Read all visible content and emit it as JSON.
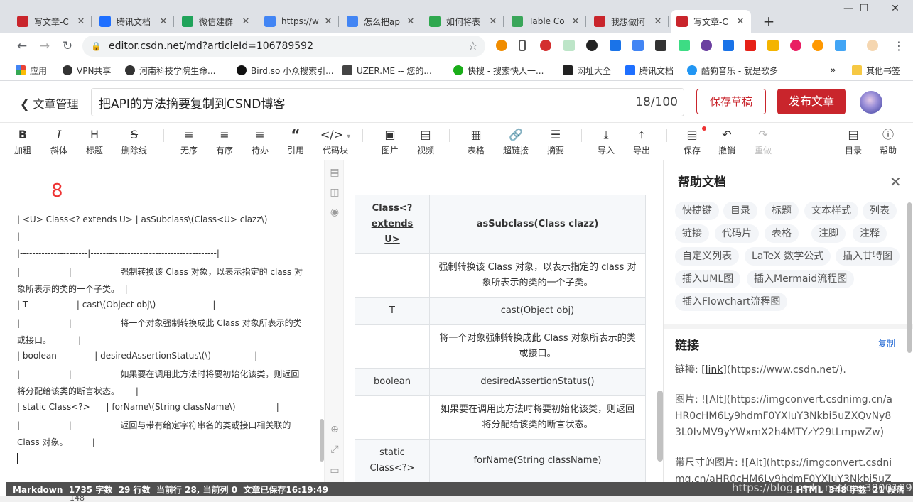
{
  "browser": {
    "tabs": [
      {
        "title": "写文章-C",
        "favicon": "csdn-c-icon",
        "color": "#c9252c"
      },
      {
        "title": "腾讯文档",
        "favicon": "tencent-docs-icon",
        "color": "#1e6fff"
      },
      {
        "title": "微信建群",
        "favicon": "sheet-icon",
        "color": "#20a35a"
      },
      {
        "title": "https://w",
        "favicon": "google-g-icon",
        "color": "#4285f4"
      },
      {
        "title": "怎么把ap",
        "favicon": "google-g-icon",
        "color": "#4285f4"
      },
      {
        "title": "如何将表",
        "favicon": "green-c-icon",
        "color": "#2fa84f"
      },
      {
        "title": "Table Co",
        "favicon": "grid-app-icon",
        "color": "#3aa65a"
      },
      {
        "title": "我想做阿",
        "favicon": "csdn-c-icon",
        "color": "#c9252c"
      },
      {
        "title": "写文章-C",
        "favicon": "csdn-c-icon",
        "color": "#c9252c"
      }
    ],
    "new_tab": "+",
    "url": "editor.csdn.net/md?articleId=106789592",
    "bookmarks": [
      "应用",
      "VPN共享",
      "河南科技学院生命...",
      "Bird.so 小众搜索引...",
      "UZER.ME -- 您的...",
      "快搜 - 搜索快人一...",
      "网址大全",
      "腾讯文档",
      "酷狗音乐 - 就是歌多"
    ],
    "bookmarks_more": "»",
    "other_bookmarks": "其他书签"
  },
  "editor": {
    "back_label": "文章管理",
    "title": "把API的方法摘要复制到CSND博客",
    "title_count": "18/100",
    "save_draft": "保存草稿",
    "publish": "发布文章"
  },
  "toolbar": {
    "bold": "加粗",
    "italic": "斜体",
    "heading": "标题",
    "strike": "删除线",
    "unordered": "无序",
    "ordered": "有序",
    "todo": "待办",
    "quote": "引用",
    "codeblock": "代码块",
    "image": "图片",
    "video": "视频",
    "table": "表格",
    "link": "超链接",
    "summary": "摘要",
    "import": "导入",
    "export": "导出",
    "save": "保存",
    "undo": "撤销",
    "redo": "重做",
    "toc": "目录",
    "help": "帮助"
  },
  "markdown": {
    "big_number": "8",
    "lines": [
      "| <U> Class<? extends U> | asSubclass\\(Class<U> clazz\\)",
      "|",
      "|----------------------|-----------------------------------------|",
      "|                  |                  强制转换该 Class 对象，以表示指定的 class 对",
      "象所表示的类的一个子类。  |",
      "| T                  | cast\\(Object obj\\)                     |",
      "|                  |                  将一个对象强制转换成此 Class 对象所表示的类",
      "或接口。          |",
      "| boolean              | desiredAssertionStatus\\(\\)                |",
      "|                  |                  如果要在调用此方法时将要初始化该类，则返回",
      "将分配给该类的断言状态。      |",
      "| static Class<?>      | forName\\(String className\\)               |",
      "|                  |                  返回与带有给定字符串名的类或接口相关联的",
      "Class 对象。         |"
    ]
  },
  "preview": {
    "header": [
      "Class<? extends U>",
      "asSubclass(Class clazz)"
    ],
    "rows": [
      [
        "",
        "强制转换该 Class 对象，以表示指定的 class 对象所表示的类的一个子类。"
      ],
      [
        "T",
        "cast(Object obj)"
      ],
      [
        "",
        "将一个对象强制转换成此 Class 对象所表示的类或接口。"
      ],
      [
        "boolean",
        "desiredAssertionStatus()"
      ],
      [
        "",
        "如果要在调用此方法时将要初始化该类，则返回将分配给该类的断言状态。"
      ],
      [
        "static Class<?>",
        "forName(String className)"
      ],
      [
        "",
        "返回与带有给定字符串名的类或接口相关联的"
      ]
    ]
  },
  "help": {
    "title": "帮助文档",
    "chips": [
      "快捷键",
      "目录",
      "标题",
      "文本样式",
      "列表",
      "链接",
      "代码片",
      "表格",
      "注脚",
      "注释",
      "自定义列表",
      "LaTeX 数学公式",
      "插入甘特图",
      "插入UML图",
      "插入Mermaid流程图",
      "插入Flowchart流程图"
    ],
    "section_title": "链接",
    "copy": "复制",
    "link_prefix": "链接: [",
    "link_word": "link",
    "link_suffix": "](https://www.csdn.net/).",
    "image_text": "图片: ![Alt](https://imgconvert.csdnimg.cn/aHR0cHM6Ly9hdmF0YXIuY3Nkbi5uZXQvNy83L0IvMV9yYWxmX2h4MTYzY29tLmpwZw)",
    "sized_image_text": "带尺寸的图片: ![Alt](https://imgconvert.csdnimg.cn/aHR0cHM6Ly9hdmF0YXIuY3Nkbi5uZ"
  },
  "status": {
    "left": "Markdown  1735 字数  29 行数  当前行 28, 当前列 0  文章已保存16:19:49",
    "right": "HTML  348 字数  21 段落",
    "watermark": "https://blog.csdn.net/qq_38001892",
    "below": "148"
  }
}
